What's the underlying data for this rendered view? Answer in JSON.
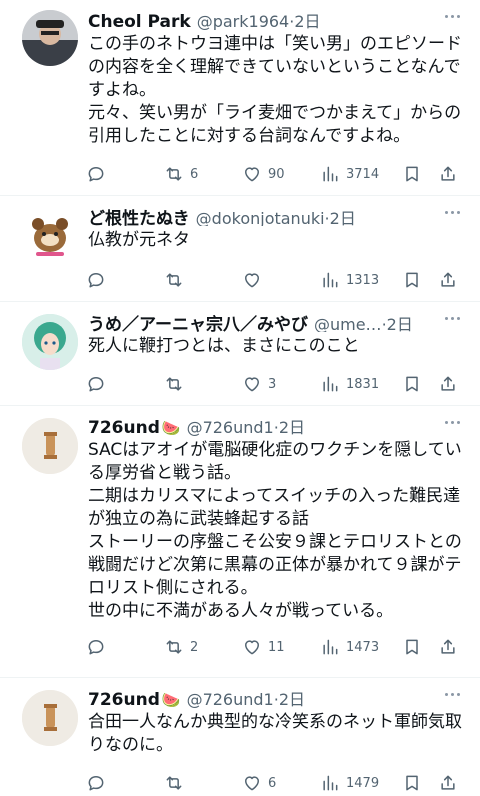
{
  "replies": [
    {
      "name": "Cheol Park",
      "handle": "@park1964",
      "time": "2日",
      "text": "この手のネトウヨ連中は「笑い男」のエピソードの内容を全く理解できていないということなんですよね。\n元々、笑い男が「ライ麦畑でつかまえて」からの引用したことに対する台詞なんですよね。",
      "emoji": "",
      "stats": {
        "replies": "",
        "reposts": "6",
        "likes": "90",
        "views": "3714"
      }
    },
    {
      "name": "ど根性たぬき",
      "handle": "@dokonjotanuki",
      "time": "2日",
      "text": "仏教が元ネタ",
      "emoji": "",
      "stats": {
        "replies": "",
        "reposts": "",
        "likes": "",
        "views": "1313"
      }
    },
    {
      "name": "うめ／アーニャ宗八／みやび",
      "handle": "@ume…",
      "time": "2日",
      "text": "死人に鞭打つとは、まさにこのこと",
      "emoji": "",
      "stats": {
        "replies": "",
        "reposts": "",
        "likes": "3",
        "views": "1831"
      }
    },
    {
      "name": "726und",
      "handle": "@726und1",
      "time": "2日",
      "text": "SACはアオイが電脳硬化症のワクチンを隠している厚労省と戦う話。\n二期はカリスマによってスイッチの入った難民達が独立の為に武装蜂起する話\nストーリーの序盤こそ公安９課とテロリストとの戦闘だけど次第に黒幕の正体が暴かれて９課がテロリスト側にされる。\n世の中に不満がある人々が戦っている。",
      "emoji": "🍉",
      "stats": {
        "replies": "",
        "reposts": "2",
        "likes": "11",
        "views": "1473"
      }
    },
    {
      "name": "726und",
      "handle": "@726und1",
      "time": "2日",
      "text": "合田一人なんか典型的な冷笑系のネット軍師気取りなのに。",
      "emoji": "🍉",
      "stats": {
        "replies": "",
        "reposts": "",
        "likes": "6",
        "views": "1479"
      }
    }
  ],
  "icons": {
    "reply": "speech-bubble",
    "repost": "two-arrows-loop",
    "like": "heart",
    "views": "bar-chart",
    "bookmark": "bookmark",
    "share": "share-up-arrow",
    "more": "three-dots"
  },
  "colors": {
    "text": "#0f1419",
    "muted": "#536471",
    "divider": "#eff3f4"
  }
}
